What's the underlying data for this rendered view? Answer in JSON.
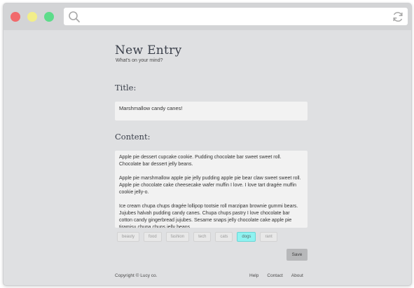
{
  "browser": {
    "icons": {
      "search": "search-icon",
      "reload": "reload-icon"
    },
    "colors": {
      "close": "#f16a6c",
      "minimize": "#f2ee8a",
      "maximize": "#5ddc8a"
    }
  },
  "page": {
    "heading": "New Entry",
    "subheading": "What's on your mind?"
  },
  "form": {
    "title_label": "Title:",
    "title_value": "Marshmallow candy canes!",
    "content_label": "Content:",
    "content_paragraphs": [
      "Apple pie dessert cupcake cookie. Pudding chocolate bar sweet sweet roll. Chocolate bar dessert jelly beans.",
      "Apple pie marshmallow apple pie jelly pudding apple pie bear claw sweet sweet roll. Apple pie chocolate cake cheesecake wafer muffin I love. I love tart dragée muffin cookie jelly-o.",
      "Ice cream chupa chups dragée lollipop tootsie roll marzipan brownie gummi bears. Jujubes halvah pudding candy canes. Chupa chups pastry I love chocolate bar cotton candy gingerbread jujubes. Sesame snaps jelly chocolate cake apple pie tiramisu chupa chups jelly beans."
    ],
    "tags": [
      "beauty",
      "food",
      "fashion",
      "tech",
      "cats",
      "dogs",
      "rant"
    ],
    "active_tag": "dogs",
    "save_label": "Save"
  },
  "footer": {
    "copyright": "Copyright © Lucy co.",
    "links": [
      "Help",
      "Contact",
      "About"
    ]
  }
}
